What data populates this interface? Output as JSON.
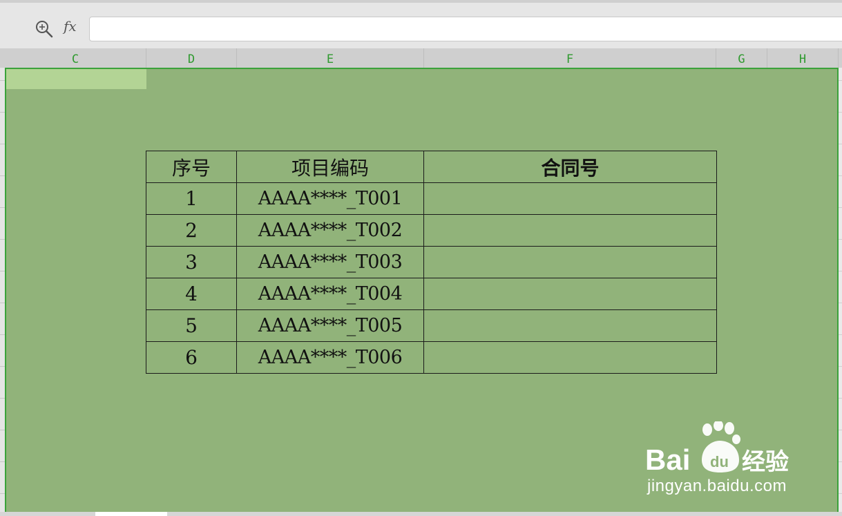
{
  "formula_bar": {
    "fx_label": "fx",
    "value": ""
  },
  "columns": [
    "C",
    "D",
    "E",
    "F",
    "G",
    "H"
  ],
  "table": {
    "headers": [
      "序号",
      "项目编码",
      "合同号"
    ],
    "rows": [
      [
        "1",
        "AAAA****_T001",
        ""
      ],
      [
        "2",
        "AAAA****_T002",
        ""
      ],
      [
        "3",
        "AAAA****_T003",
        ""
      ],
      [
        "4",
        "AAAA****_T004",
        ""
      ],
      [
        "5",
        "AAAA****_T005",
        ""
      ],
      [
        "6",
        "AAAA****_T006",
        ""
      ]
    ]
  },
  "watermark": {
    "brand": "Baidu经验",
    "url": "jingyan.baidu.com"
  },
  "colors": {
    "grid_fill": "#91b37a",
    "selection_border": "#3aa23a",
    "active_cell": "#b3d495",
    "column_letter": "#2f9a2f"
  },
  "icons": {
    "zoom": "zoom-icon"
  }
}
